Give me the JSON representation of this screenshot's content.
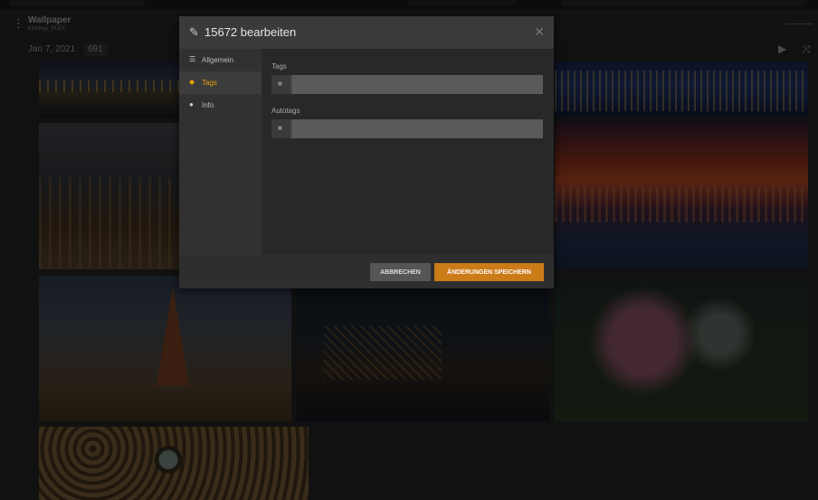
{
  "library": {
    "title": "Wallpaper",
    "subtitle": "b14dkyy_PLEX",
    "date": "Jan 7, 2021",
    "count": "691"
  },
  "icons": {
    "menu": "kebab-icon",
    "play": "play-icon",
    "shuffle": "shuffle-icon",
    "edit": "pencil-icon",
    "close": "close-icon",
    "general": "list-icon",
    "tags": "tag-icon",
    "info": "info-icon",
    "lock": "lock-icon"
  },
  "modal": {
    "title": "15672 bearbeiten",
    "sidebar": [
      {
        "label": "Allgemein",
        "active": false
      },
      {
        "label": "Tags",
        "active": true
      },
      {
        "label": "Info",
        "active": false
      }
    ],
    "fields": [
      {
        "label": "Tags",
        "value": ""
      },
      {
        "label": "Autotags",
        "value": ""
      }
    ],
    "buttons": {
      "cancel": "ABBRECHEN",
      "save": "ÄNDERUNGEN SPEICHERN"
    }
  },
  "colors": {
    "accent": "#e5a00d",
    "save_button": "#cc7b19"
  }
}
